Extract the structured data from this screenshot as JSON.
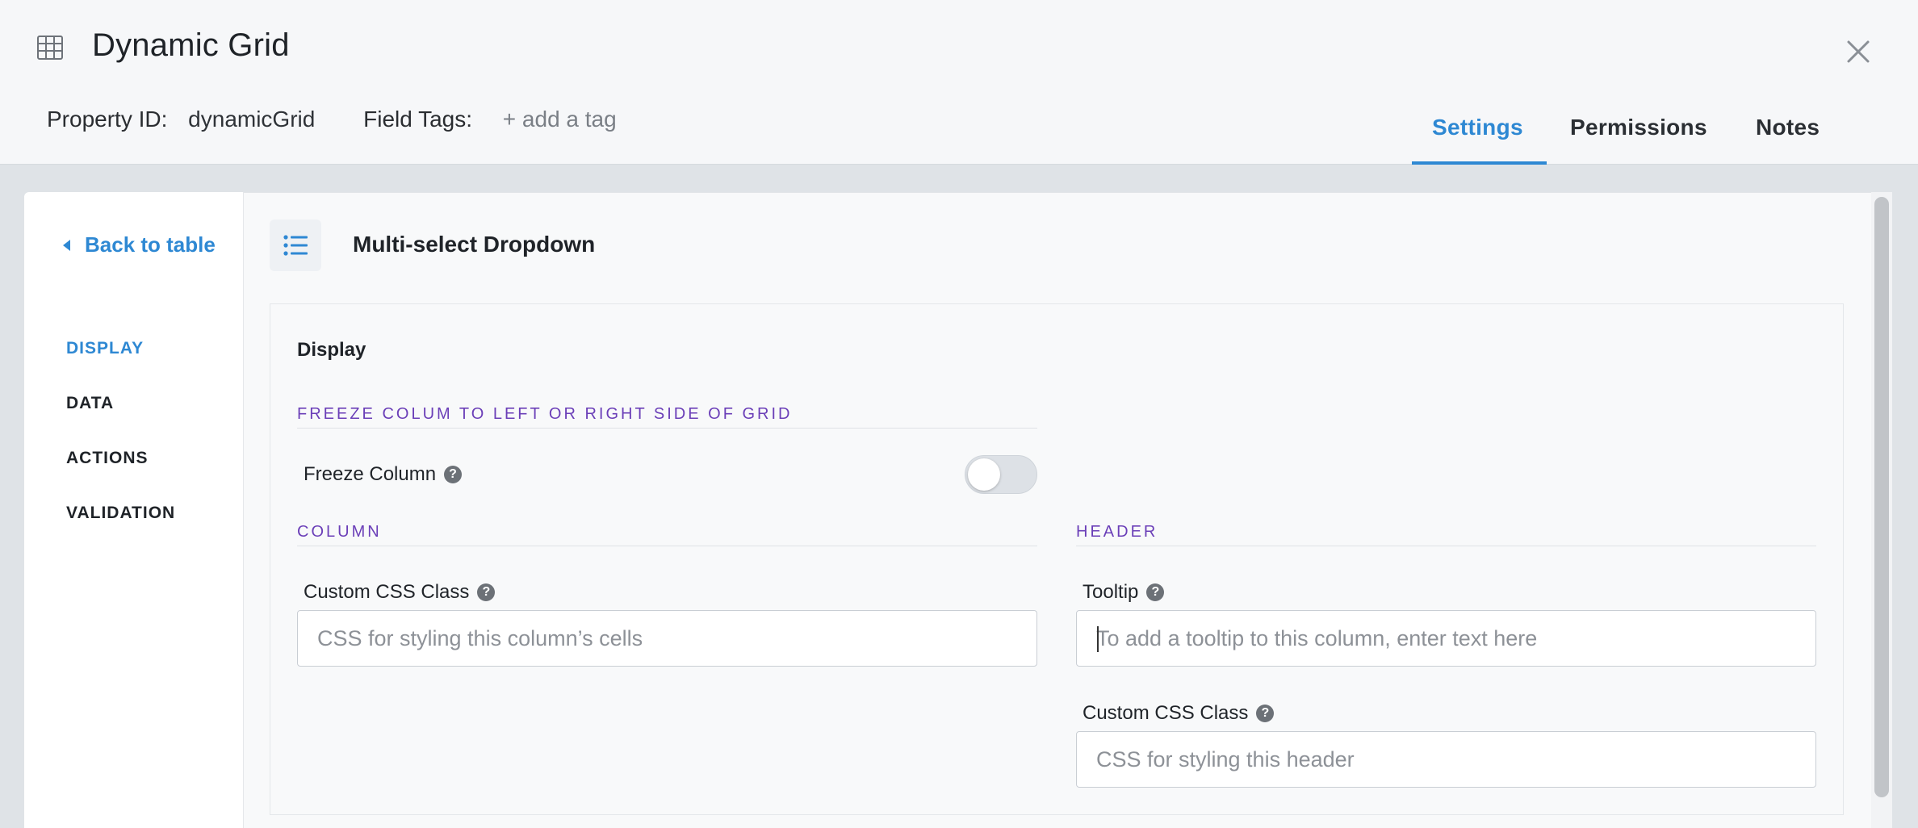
{
  "header": {
    "title": "Dynamic Grid",
    "icon": "grid-icon",
    "property_id_label": "Property ID:",
    "property_id_value": "dynamicGrid",
    "field_tags_label": "Field Tags:",
    "add_tag_label": "+ add a tag",
    "tabs": [
      {
        "label": "Settings",
        "active": true
      },
      {
        "label": "Permissions",
        "active": false
      },
      {
        "label": "Notes",
        "active": false
      }
    ]
  },
  "sidebar": {
    "back_label": "Back to table",
    "items": [
      {
        "label": "DISPLAY",
        "active": true
      },
      {
        "label": "DATA",
        "active": false
      },
      {
        "label": "ACTIONS",
        "active": false
      },
      {
        "label": "VALIDATION",
        "active": false
      }
    ]
  },
  "main": {
    "widget_title": "Multi-select Dropdown",
    "widget_icon": "list-icon",
    "section_title": "Display",
    "freeze_group_label": "FREEZE COLUM TO LEFT OR RIGHT SIDE OF GRID",
    "freeze_column_label": "Freeze Column",
    "freeze_column_enabled": false,
    "column_group_label": "COLUMN",
    "header_group_label": "HEADER",
    "column_css_label": "Custom CSS Class",
    "column_css_placeholder": "CSS for styling this column’s cells",
    "column_css_value": "",
    "tooltip_label": "Tooltip",
    "tooltip_placeholder": "To add a tooltip to this column, enter text here",
    "tooltip_value": "",
    "header_css_label": "Custom CSS Class",
    "header_css_placeholder": "CSS for styling this header",
    "header_css_value": ""
  },
  "colors": {
    "accent": "#2e88d3",
    "group_label": "#6b3fb8"
  }
}
